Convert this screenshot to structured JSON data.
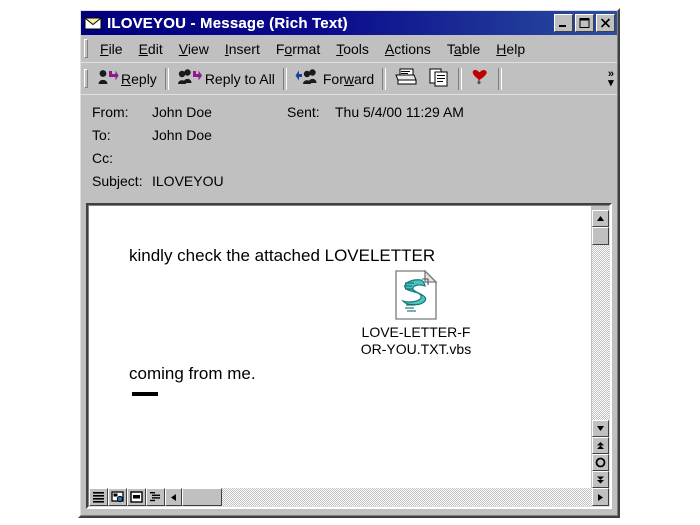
{
  "window": {
    "title": "ILOVEYOU - Message (Rich Text)",
    "icon": "envelope-icon",
    "controls": {
      "minimize": "Minimize",
      "maximize": "Maximize",
      "close": "Close"
    }
  },
  "menubar": {
    "items": [
      {
        "label": "File",
        "accel": "F"
      },
      {
        "label": "Edit",
        "accel": "E"
      },
      {
        "label": "View",
        "accel": "V"
      },
      {
        "label": "Insert",
        "accel": "I"
      },
      {
        "label": "Format",
        "accel": "o"
      },
      {
        "label": "Tools",
        "accel": "T"
      },
      {
        "label": "Actions",
        "accel": "A"
      },
      {
        "label": "Table",
        "accel": "a"
      },
      {
        "label": "Help",
        "accel": "H"
      }
    ]
  },
  "toolbar": {
    "reply_label": "Reply",
    "reply_all_label": "Reply to All",
    "forward_label": "Forward",
    "print_label": "Print",
    "copy_label": "Copy",
    "flag_label": "Flag for Follow Up",
    "overflow_label": "»"
  },
  "headers": {
    "from_label": "From:",
    "from_value": "John Doe",
    "sent_label": "Sent:",
    "sent_value": "Thu 5/4/00 11:29 AM",
    "to_label": "To:",
    "to_value": "John Doe",
    "cc_label": "Cc:",
    "cc_value": "",
    "subject_label": "Subject:",
    "subject_value": "ILOVEYOU"
  },
  "body": {
    "line1": "kindly check the attached LOVELETTER",
    "line2": "coming from me.",
    "attachment": {
      "name": "LOVE-LETTER-FOR-YOU.TXT.vbs",
      "icon": "vbs-script-file-icon"
    }
  },
  "statusbar": {
    "view_buttons": [
      {
        "name": "normal-view",
        "label": "Normal View"
      },
      {
        "name": "web-layout-view",
        "label": "Web Layout View"
      },
      {
        "name": "print-layout-view",
        "label": "Print Layout View"
      },
      {
        "name": "outline-view",
        "label": "Outline View"
      }
    ]
  },
  "scrollbar": {
    "up_label": "Scroll Up",
    "down_label": "Scroll Down",
    "prev_page_label": "Previous Page",
    "browse_object_label": "Select Browse Object",
    "next_page_label": "Next Page",
    "left_label": "Scroll Left",
    "right_label": "Scroll Right"
  },
  "colors": {
    "titlebar_start": "#00007e",
    "titlebar_end": "#2a4fa0",
    "face": "#c0c0c0",
    "document": "#ffffff",
    "icon_accent": "#8b1a8b",
    "script_icon": "#4fc3c3",
    "flag": "#c00000"
  }
}
